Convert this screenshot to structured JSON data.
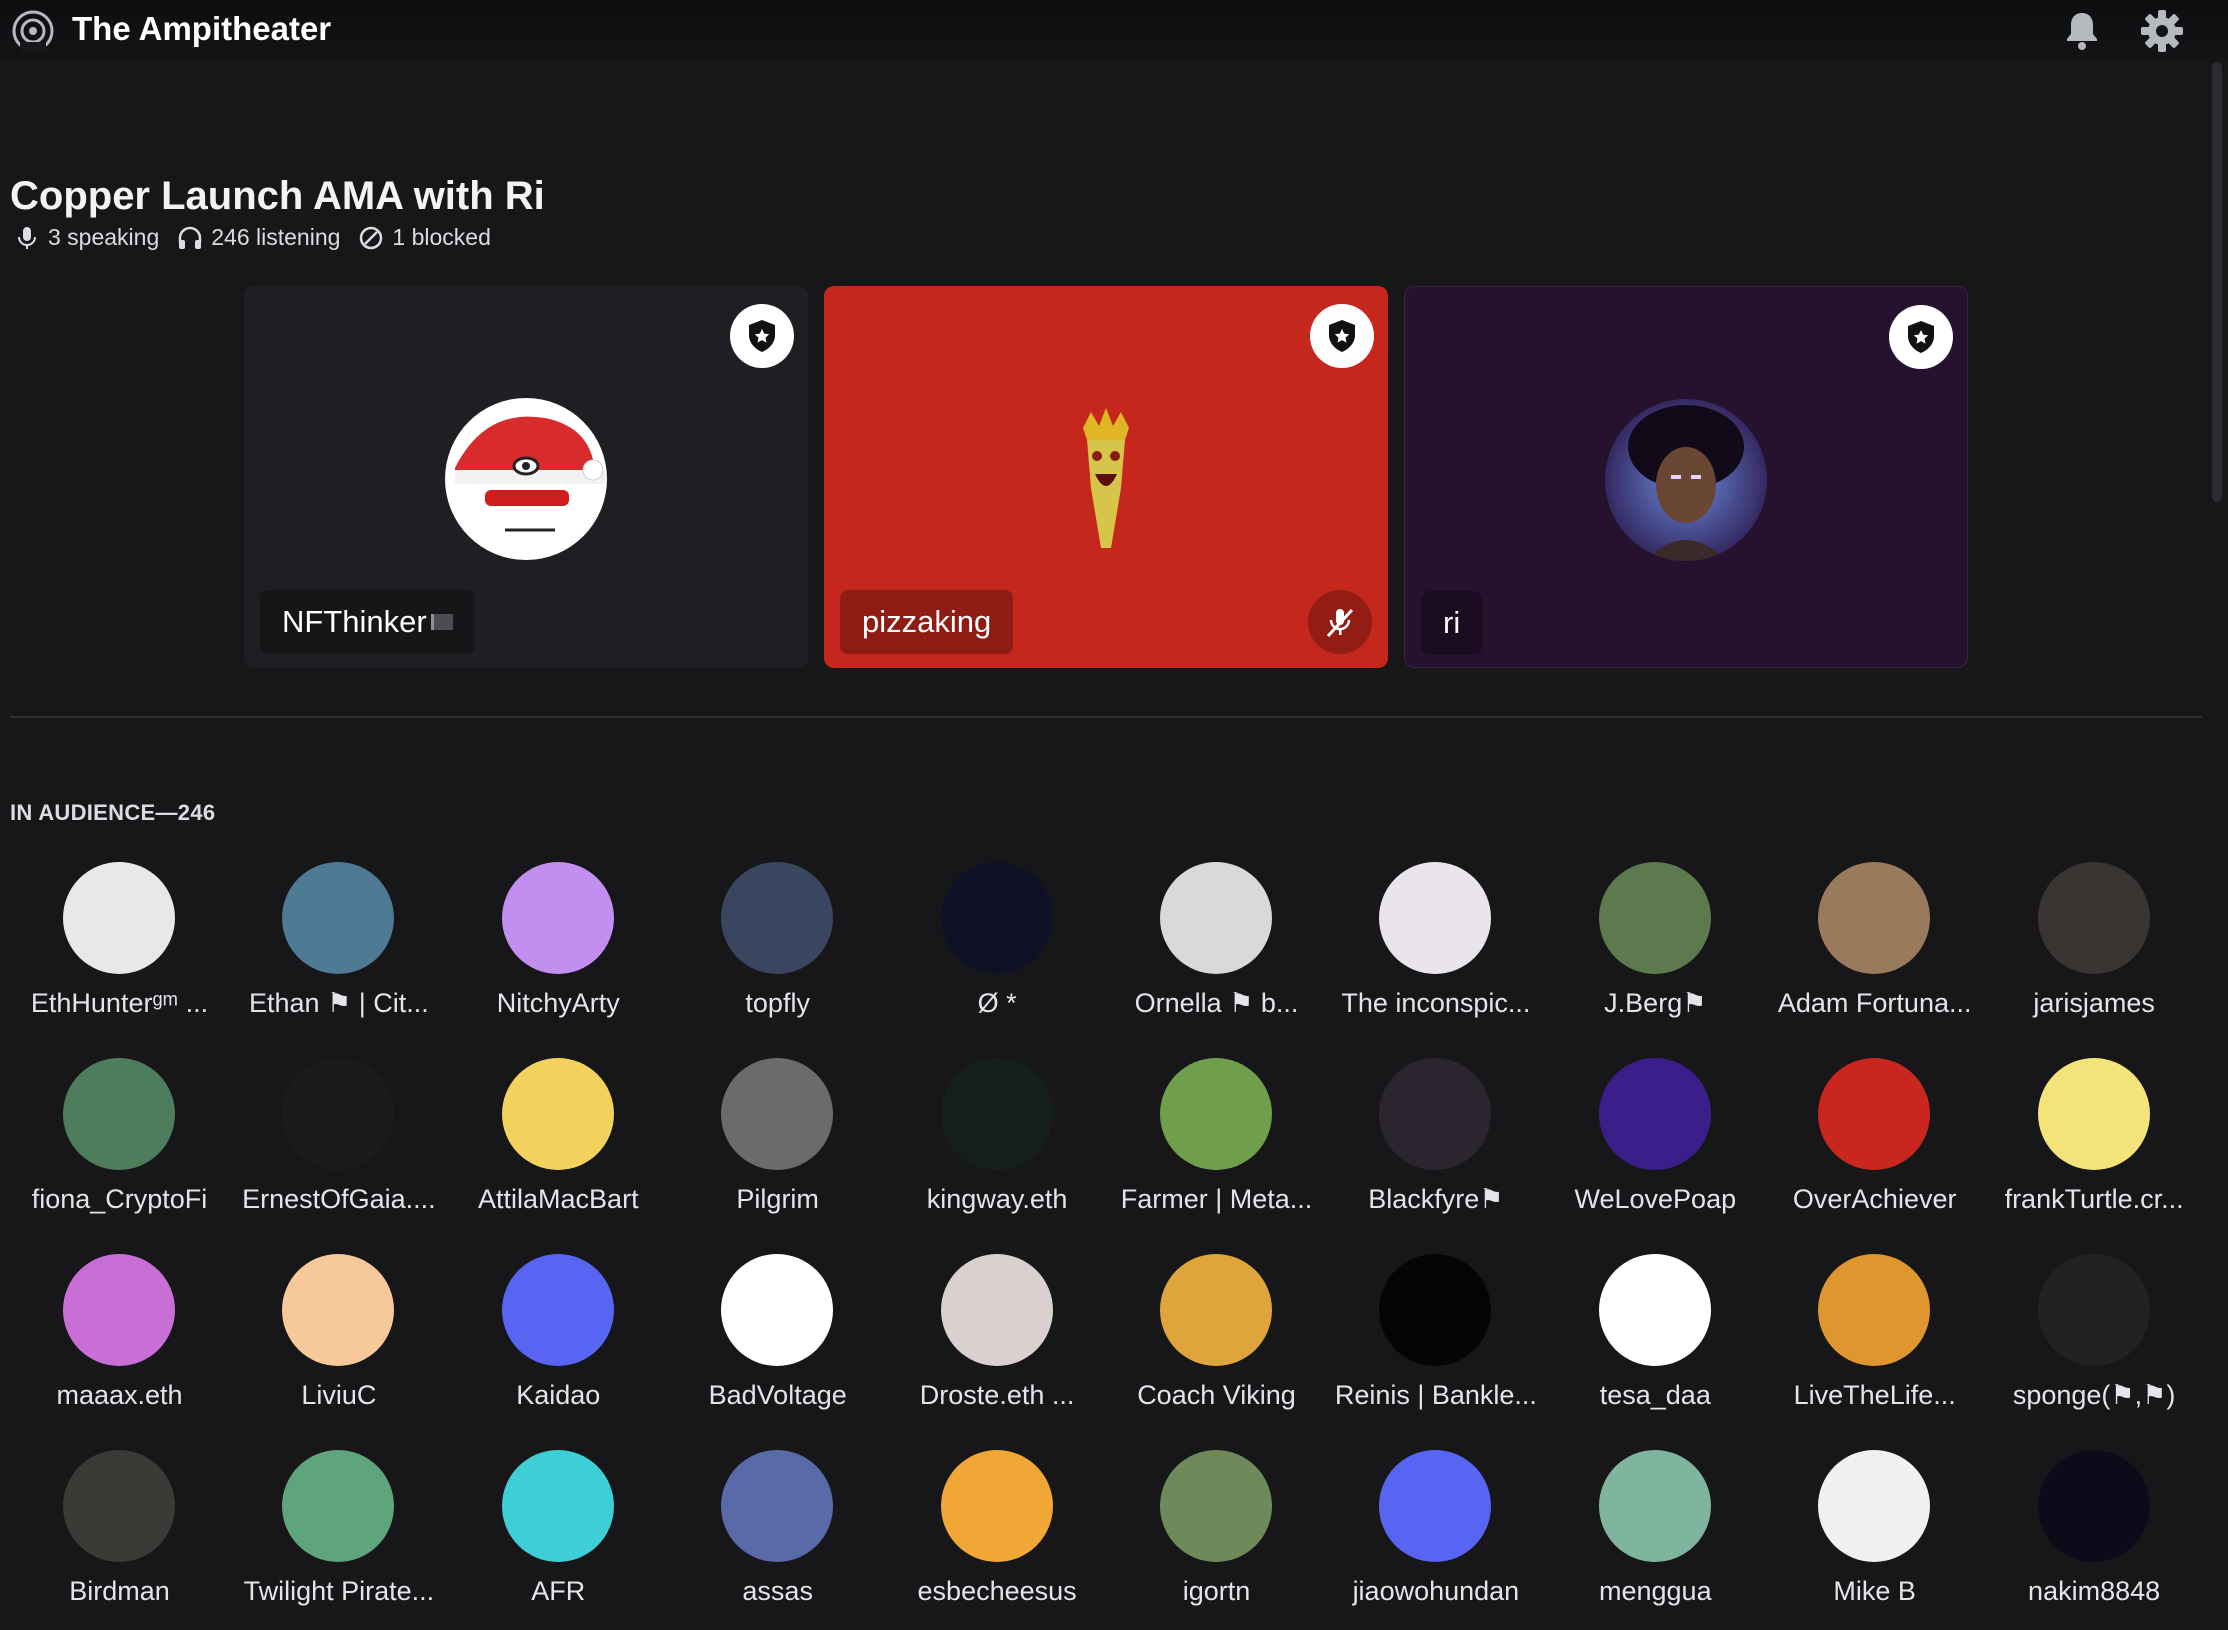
{
  "header": {
    "title": "The Ampitheater",
    "icons": [
      "stage-channel-icon",
      "bell-icon",
      "gear-icon"
    ]
  },
  "stage": {
    "title": "Copper Launch AMA with Ri",
    "speaking": "3 speaking",
    "listening": "246 listening",
    "blocked": "1 blocked"
  },
  "speakers": [
    {
      "name": "NFThinker",
      "bg": "#1f1f23",
      "muted": false,
      "moderator": true
    },
    {
      "name": "pizzaking",
      "bg": "#c5271c",
      "muted": true,
      "moderator": true
    },
    {
      "name": "ri",
      "bg": "#26112f",
      "muted": false,
      "moderator": true
    }
  ],
  "audience": {
    "header": "IN AUDIENCE—246",
    "members": [
      {
        "name": "EthHunterᵍᵐ ...",
        "color": "#e8e8e8"
      },
      {
        "name": "Ethan ⚑ | Cit...",
        "color": "#4f7a93"
      },
      {
        "name": "NitchyArty",
        "color": "#c28ff0"
      },
      {
        "name": "topfly",
        "color": "#3a4660"
      },
      {
        "name": "Ø *",
        "color": "#0f1226"
      },
      {
        "name": "Ornella ⚑ b...",
        "color": "#d9d9d9"
      },
      {
        "name": "The inconspic...",
        "color": "#e9e5ea"
      },
      {
        "name": "J.Berg⚑",
        "color": "#5d7a4f"
      },
      {
        "name": "Adam Fortuna...",
        "color": "#9a7a5c"
      },
      {
        "name": "jarisjames",
        "color": "#3a3433"
      },
      {
        "name": "fiona_CryptoFi",
        "color": "#4e7d5d"
      },
      {
        "name": "ErnestOfGaia....",
        "color": "#1b1b1b"
      },
      {
        "name": "AttilaMacBart",
        "color": "#f2d25c"
      },
      {
        "name": "Pilgrim",
        "color": "#6b6b6b"
      },
      {
        "name": "kingway.eth",
        "color": "#15201c"
      },
      {
        "name": "Farmer | Meta...",
        "color": "#6f9f4c"
      },
      {
        "name": "Blackfyre⚑",
        "color": "#2b2530"
      },
      {
        "name": "WeLovePoap",
        "color": "#3b1e8a"
      },
      {
        "name": "OverAchiever",
        "color": "#c8261e"
      },
      {
        "name": "frankTurtle.cr...",
        "color": "#f4e27a"
      },
      {
        "name": "maaax.eth",
        "color": "#c86fd6"
      },
      {
        "name": "LiviuC",
        "color": "#f7c99a"
      },
      {
        "name": "Kaidao",
        "color": "#5865f2"
      },
      {
        "name": "BadVoltage",
        "color": "#ffffff"
      },
      {
        "name": "Droste.eth ...",
        "color": "#d9d0cf"
      },
      {
        "name": "Coach Viking",
        "color": "#e0a53a"
      },
      {
        "name": "Reinis | Bankle...",
        "color": "#050505"
      },
      {
        "name": "tesa_daa",
        "color": "#ffffff"
      },
      {
        "name": "LiveTheLife...",
        "color": "#e0962e"
      },
      {
        "name": "sponge(⚑,⚑)",
        "color": "#222222"
      },
      {
        "name": "Birdman",
        "color": "#3b3a36"
      },
      {
        "name": "Twilight Pirate...",
        "color": "#5fa57c"
      },
      {
        "name": "AFR",
        "color": "#3dcfd5"
      },
      {
        "name": "assas",
        "color": "#5a69a8"
      },
      {
        "name": "esbecheesus",
        "color": "#f0a736"
      },
      {
        "name": "igortn",
        "color": "#6f8a5a"
      },
      {
        "name": "jiaowohundan",
        "color": "#5865f2"
      },
      {
        "name": "menggua",
        "color": "#7fb59e"
      },
      {
        "name": "Mike B",
        "color": "#f0f0f0"
      },
      {
        "name": "nakim8848",
        "color": "#0d0b1a"
      }
    ]
  }
}
